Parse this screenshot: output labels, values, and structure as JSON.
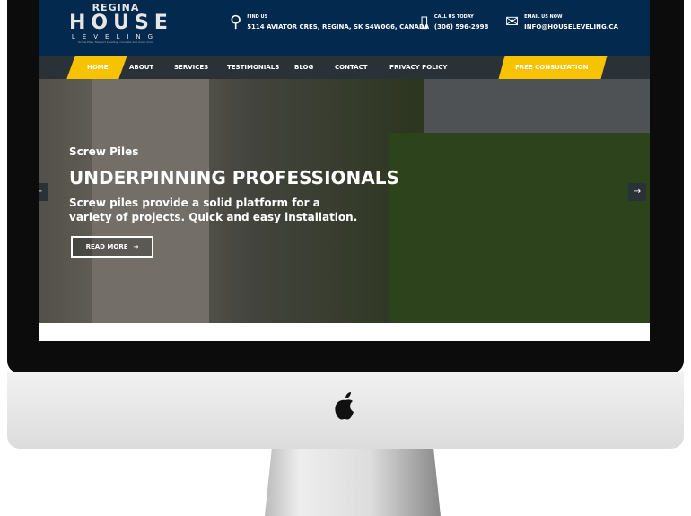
{
  "logo": {
    "line1": "REGINA",
    "line2": "HOUSE",
    "line3": "LEVELING",
    "tagline": "Screw Piles, Teleport Leveling, concrete and much more"
  },
  "contact": [
    {
      "icon": "map-pin-icon",
      "label": "FIND US",
      "value": "5114 AVIATOR CRES, REGINA, SK S4W0G6, CANADA"
    },
    {
      "icon": "phone-icon",
      "label": "CALL US TODAY",
      "value": "(306) 596-2998"
    },
    {
      "icon": "mail-icon",
      "label": "EMAIL US NOW",
      "value": "INFO@HOUSELEVELING.CA"
    }
  ],
  "nav": {
    "items": [
      "HOME",
      "ABOUT",
      "SERVICES",
      "TESTIMONIALS",
      "BLOG",
      "CONTACT",
      "PRIVACY POLICY"
    ],
    "active": "HOME",
    "cta": "FREE CONSULTATION"
  },
  "hero": {
    "subtitle": "Screw Piles",
    "title": "UNDERPINNING PROFESSIONALS",
    "text": "Screw piles provide a solid platform for a variety of projects. Quick and easy installation.",
    "button": "READ MORE",
    "button_icon": "→",
    "prev": "←",
    "next": "→"
  },
  "colors": {
    "navy": "#03294e",
    "accent": "#f7c300",
    "nav": "#2a3237"
  },
  "device": {
    "logo": ""
  }
}
